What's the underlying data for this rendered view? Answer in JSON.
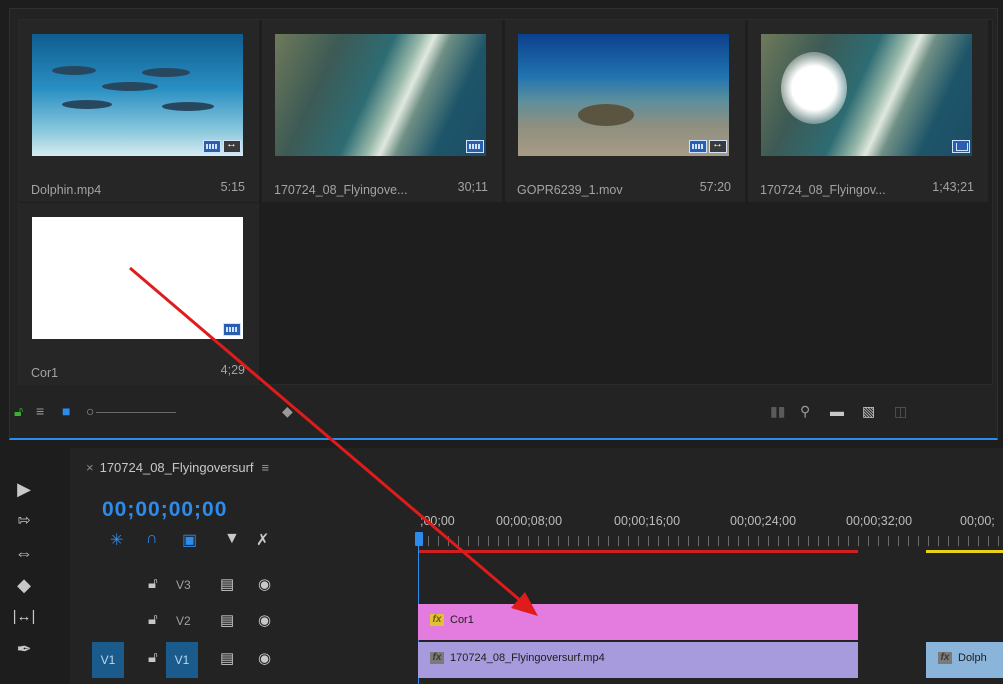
{
  "project": {
    "clips": [
      {
        "name": "Dolphin.mp4",
        "duration": "5:15"
      },
      {
        "name": "170724_08_Flyingove...",
        "duration": "30;11"
      },
      {
        "name": "GOPR6239_1.mov",
        "duration": "57:20"
      },
      {
        "name": "170724_08_Flyingov...",
        "duration": "1;43;21"
      },
      {
        "name": "Cor1",
        "duration": "4;29"
      }
    ],
    "toolbar_icons": [
      "lock-icon",
      "list-view-icon",
      "icon-view-icon",
      "zoom-slider",
      "sort-icon",
      "automate-icon",
      "find-icon",
      "new-bin-icon",
      "new-item-icon",
      "trash-icon"
    ]
  },
  "tools": [
    "selection-tool-icon",
    "track-select-tool-icon",
    "ripple-edit-tool-icon",
    "razor-tool-icon",
    "slip-tool-icon",
    "pen-tool-icon"
  ],
  "timeline": {
    "tab_close": "×",
    "sequence_name": "170724_08_Flyingoversurf",
    "tab_menu": "≡",
    "timecode": "00;00;00;00",
    "ruler_labels": [
      ";00;00",
      "00;00;08;00",
      "00;00;16;00",
      "00;00;24;00",
      "00;00;32;00",
      "00;00;"
    ],
    "tracks": [
      {
        "label": "V3"
      },
      {
        "label": "V2"
      },
      {
        "label": "V1",
        "source": "V1"
      }
    ],
    "clips": [
      {
        "name": "Cor1",
        "track": "V2",
        "color": "#e47ce0"
      },
      {
        "name": "170724_08_Flyingoversurf.mp4",
        "track": "V1",
        "color": "#a79bdd"
      },
      {
        "name": "Dolph",
        "track": "V1",
        "color": "#8ab4d9"
      }
    ],
    "fx_label": "fx"
  },
  "colors": {
    "accent": "#2d8ceb",
    "arrow": "#e01b1b",
    "in_out_bar": "#d21e1e",
    "render_bar": "#e8d21a"
  }
}
